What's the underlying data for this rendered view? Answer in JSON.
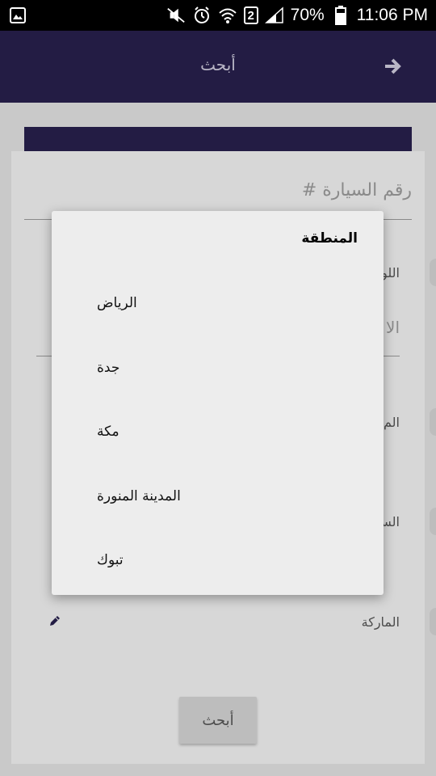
{
  "status_bar": {
    "battery": "70%",
    "time": "11:06 PM",
    "sim_badge": "2"
  },
  "app_bar": {
    "title": "أبحث"
  },
  "form": {
    "car_number_placeholder": "# رقم السيارة",
    "rows": [
      {
        "label": "اللو"
      },
      {
        "label": "الا"
      },
      {
        "label": "الم"
      },
      {
        "label": "الس"
      },
      {
        "label": "الماركة"
      }
    ],
    "search_button": "أبحث"
  },
  "dialog": {
    "title": "المنطقة",
    "options": [
      "الرياض",
      "جدة",
      "مكة",
      "المدينة المنورة",
      "تبوك"
    ]
  },
  "colors": {
    "primary": "#231c44",
    "scrim": "#c9c9c9",
    "dialog_bg": "#ededed"
  }
}
